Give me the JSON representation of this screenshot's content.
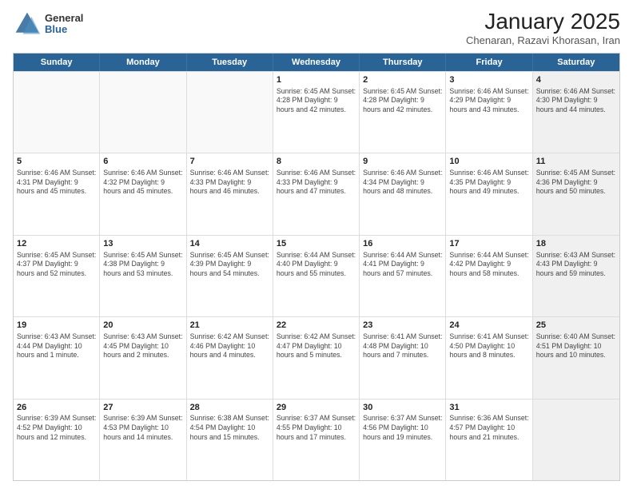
{
  "header": {
    "logo_general": "General",
    "logo_blue": "Blue",
    "month_title": "January 2025",
    "subtitle": "Chenaran, Razavi Khorasan, Iran"
  },
  "weekdays": [
    "Sunday",
    "Monday",
    "Tuesday",
    "Wednesday",
    "Thursday",
    "Friday",
    "Saturday"
  ],
  "rows": [
    [
      {
        "day": "",
        "info": "",
        "empty": true
      },
      {
        "day": "",
        "info": "",
        "empty": true
      },
      {
        "day": "",
        "info": "",
        "empty": true
      },
      {
        "day": "1",
        "info": "Sunrise: 6:45 AM\nSunset: 4:28 PM\nDaylight: 9 hours and 42 minutes."
      },
      {
        "day": "2",
        "info": "Sunrise: 6:45 AM\nSunset: 4:28 PM\nDaylight: 9 hours and 42 minutes."
      },
      {
        "day": "3",
        "info": "Sunrise: 6:46 AM\nSunset: 4:29 PM\nDaylight: 9 hours and 43 minutes."
      },
      {
        "day": "4",
        "info": "Sunrise: 6:46 AM\nSunset: 4:30 PM\nDaylight: 9 hours and 44 minutes.",
        "shaded": true
      }
    ],
    [
      {
        "day": "5",
        "info": "Sunrise: 6:46 AM\nSunset: 4:31 PM\nDaylight: 9 hours and 45 minutes."
      },
      {
        "day": "6",
        "info": "Sunrise: 6:46 AM\nSunset: 4:32 PM\nDaylight: 9 hours and 45 minutes."
      },
      {
        "day": "7",
        "info": "Sunrise: 6:46 AM\nSunset: 4:33 PM\nDaylight: 9 hours and 46 minutes."
      },
      {
        "day": "8",
        "info": "Sunrise: 6:46 AM\nSunset: 4:33 PM\nDaylight: 9 hours and 47 minutes."
      },
      {
        "day": "9",
        "info": "Sunrise: 6:46 AM\nSunset: 4:34 PM\nDaylight: 9 hours and 48 minutes."
      },
      {
        "day": "10",
        "info": "Sunrise: 6:46 AM\nSunset: 4:35 PM\nDaylight: 9 hours and 49 minutes."
      },
      {
        "day": "11",
        "info": "Sunrise: 6:45 AM\nSunset: 4:36 PM\nDaylight: 9 hours and 50 minutes.",
        "shaded": true
      }
    ],
    [
      {
        "day": "12",
        "info": "Sunrise: 6:45 AM\nSunset: 4:37 PM\nDaylight: 9 hours and 52 minutes."
      },
      {
        "day": "13",
        "info": "Sunrise: 6:45 AM\nSunset: 4:38 PM\nDaylight: 9 hours and 53 minutes."
      },
      {
        "day": "14",
        "info": "Sunrise: 6:45 AM\nSunset: 4:39 PM\nDaylight: 9 hours and 54 minutes."
      },
      {
        "day": "15",
        "info": "Sunrise: 6:44 AM\nSunset: 4:40 PM\nDaylight: 9 hours and 55 minutes."
      },
      {
        "day": "16",
        "info": "Sunrise: 6:44 AM\nSunset: 4:41 PM\nDaylight: 9 hours and 57 minutes."
      },
      {
        "day": "17",
        "info": "Sunrise: 6:44 AM\nSunset: 4:42 PM\nDaylight: 9 hours and 58 minutes."
      },
      {
        "day": "18",
        "info": "Sunrise: 6:43 AM\nSunset: 4:43 PM\nDaylight: 9 hours and 59 minutes.",
        "shaded": true
      }
    ],
    [
      {
        "day": "19",
        "info": "Sunrise: 6:43 AM\nSunset: 4:44 PM\nDaylight: 10 hours and 1 minute."
      },
      {
        "day": "20",
        "info": "Sunrise: 6:43 AM\nSunset: 4:45 PM\nDaylight: 10 hours and 2 minutes."
      },
      {
        "day": "21",
        "info": "Sunrise: 6:42 AM\nSunset: 4:46 PM\nDaylight: 10 hours and 4 minutes."
      },
      {
        "day": "22",
        "info": "Sunrise: 6:42 AM\nSunset: 4:47 PM\nDaylight: 10 hours and 5 minutes."
      },
      {
        "day": "23",
        "info": "Sunrise: 6:41 AM\nSunset: 4:48 PM\nDaylight: 10 hours and 7 minutes."
      },
      {
        "day": "24",
        "info": "Sunrise: 6:41 AM\nSunset: 4:50 PM\nDaylight: 10 hours and 8 minutes."
      },
      {
        "day": "25",
        "info": "Sunrise: 6:40 AM\nSunset: 4:51 PM\nDaylight: 10 hours and 10 minutes.",
        "shaded": true
      }
    ],
    [
      {
        "day": "26",
        "info": "Sunrise: 6:39 AM\nSunset: 4:52 PM\nDaylight: 10 hours and 12 minutes."
      },
      {
        "day": "27",
        "info": "Sunrise: 6:39 AM\nSunset: 4:53 PM\nDaylight: 10 hours and 14 minutes."
      },
      {
        "day": "28",
        "info": "Sunrise: 6:38 AM\nSunset: 4:54 PM\nDaylight: 10 hours and 15 minutes."
      },
      {
        "day": "29",
        "info": "Sunrise: 6:37 AM\nSunset: 4:55 PM\nDaylight: 10 hours and 17 minutes."
      },
      {
        "day": "30",
        "info": "Sunrise: 6:37 AM\nSunset: 4:56 PM\nDaylight: 10 hours and 19 minutes."
      },
      {
        "day": "31",
        "info": "Sunrise: 6:36 AM\nSunset: 4:57 PM\nDaylight: 10 hours and 21 minutes."
      },
      {
        "day": "",
        "info": "",
        "empty": true,
        "shaded": true
      }
    ]
  ]
}
